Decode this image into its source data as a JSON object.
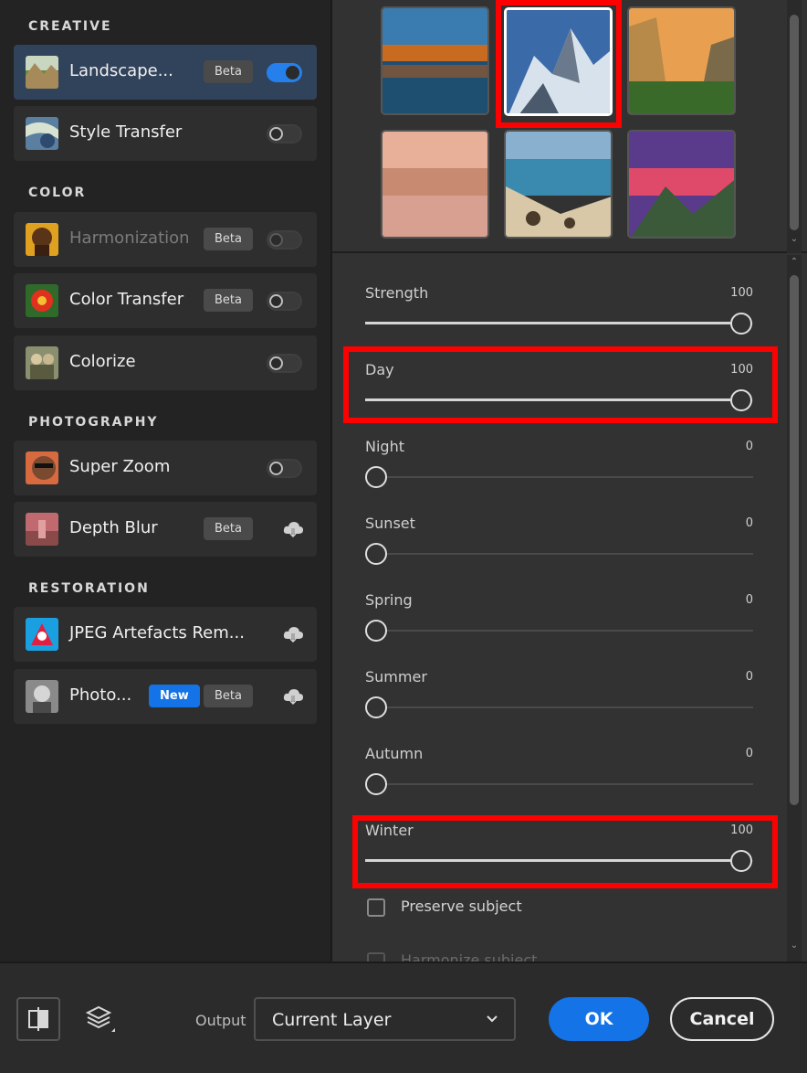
{
  "left_panel": {
    "sections": {
      "creative": "CREATIVE",
      "color": "COLOR",
      "photography": "PHOTOGRAPHY",
      "restoration": "RESTORATION"
    },
    "items": {
      "landscape": {
        "label": "Landscape...",
        "badge": "Beta",
        "toggle": "on"
      },
      "style_transfer": {
        "label": "Style Transfer",
        "toggle": "off"
      },
      "harmonization": {
        "label": "Harmonization",
        "badge": "Beta",
        "toggle": "off-disabled"
      },
      "color_transfer": {
        "label": "Color Transfer",
        "badge": "Beta",
        "toggle": "off"
      },
      "colorize": {
        "label": "Colorize",
        "toggle": "off"
      },
      "super_zoom": {
        "label": "Super Zoom",
        "toggle": "off"
      },
      "depth_blur": {
        "label": "Depth Blur",
        "badge": "Beta",
        "action_icon": "cloud-download-icon"
      },
      "jpeg_artefacts": {
        "label": "JPEG Artefacts Rem...",
        "action_icon": "cloud-download-icon"
      },
      "photo_restoration": {
        "label": "Photo...",
        "badge_new": "New",
        "badge": "Beta",
        "action_icon": "cloud-download-icon"
      }
    }
  },
  "gallery": {
    "tiles": [
      "autumn-lake",
      "snowy-mountain",
      "valley-sunset",
      "misty-river",
      "rocky-beach",
      "mountain-dusk"
    ],
    "selected_index": 1
  },
  "sliders": [
    {
      "label": "Strength",
      "value": 100
    },
    {
      "label": "Day",
      "value": 100
    },
    {
      "label": "Night",
      "value": 0
    },
    {
      "label": "Sunset",
      "value": 0
    },
    {
      "label": "Spring",
      "value": 0
    },
    {
      "label": "Summer",
      "value": 0
    },
    {
      "label": "Autumn",
      "value": 0
    },
    {
      "label": "Winter",
      "value": 100
    }
  ],
  "checkboxes": [
    {
      "label": "Preserve subject",
      "checked": false
    },
    {
      "label": "Harmonize subject",
      "checked": false
    }
  ],
  "bottom_bar": {
    "output_label": "Output",
    "output_value": "Current Layer",
    "ok": "OK",
    "cancel": "Cancel"
  },
  "colors": {
    "accent": "#1473e6",
    "highlight": "#ff0000"
  }
}
